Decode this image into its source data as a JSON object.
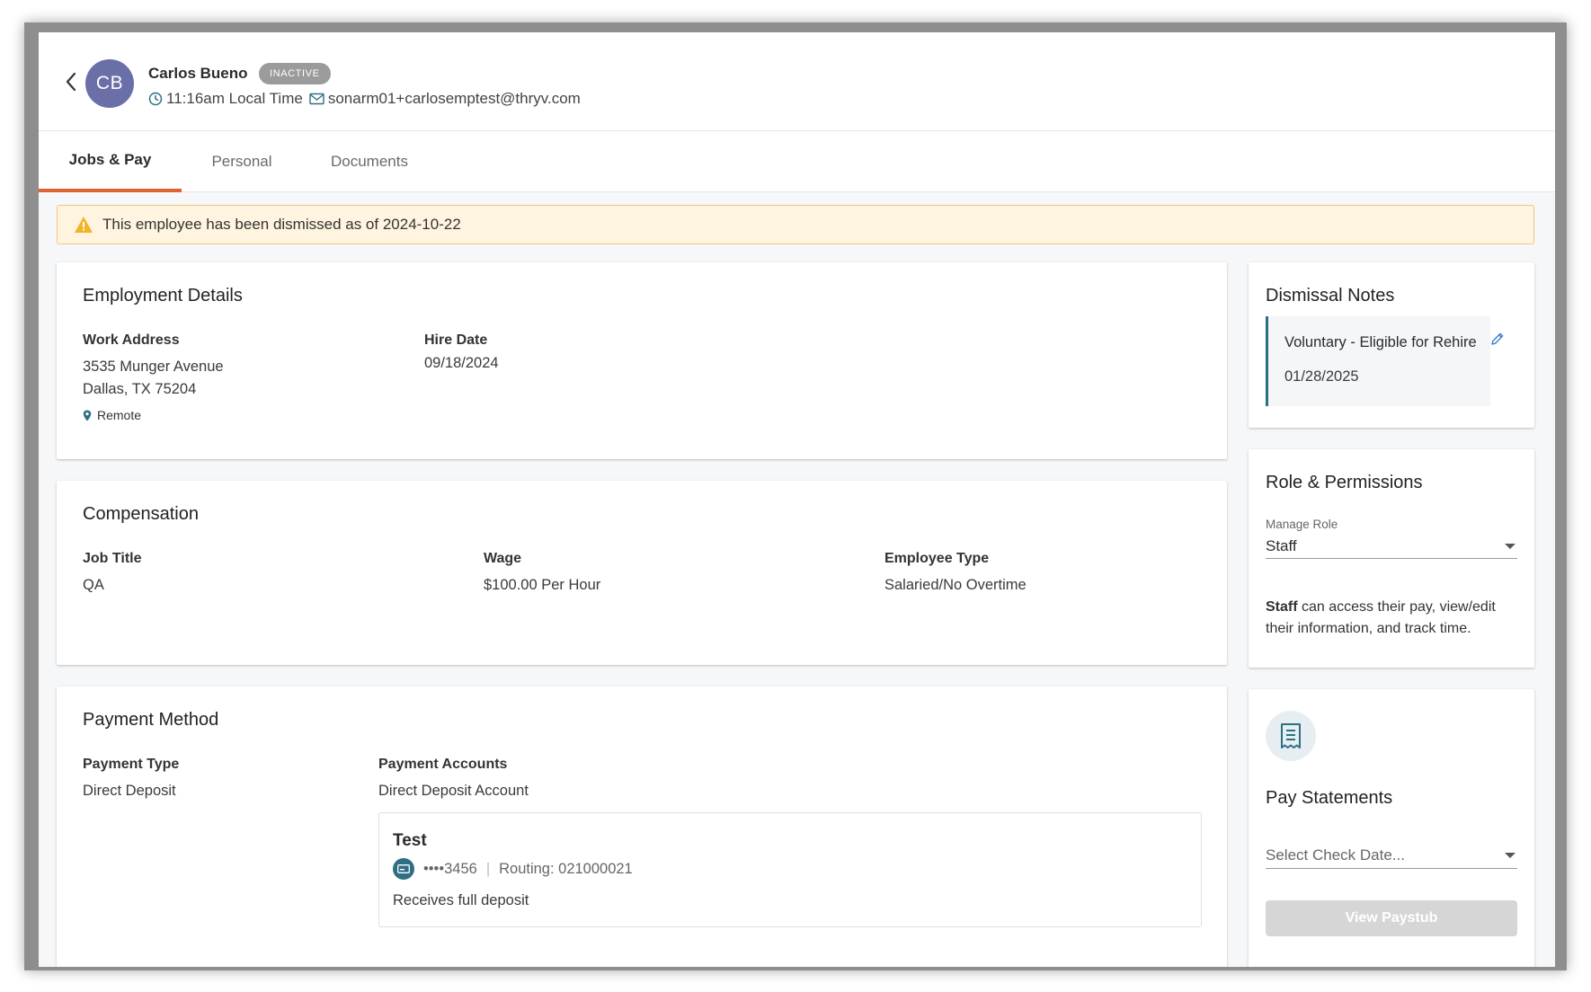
{
  "header": {
    "initials": "CB",
    "name": "Carlos Bueno",
    "status": "INACTIVE",
    "local_time": "11:16am Local Time",
    "email": "sonarm01+carlosemptest@thryv.com"
  },
  "tabs": [
    {
      "label": "Jobs & Pay",
      "active": true
    },
    {
      "label": "Personal",
      "active": false
    },
    {
      "label": "Documents",
      "active": false
    }
  ],
  "alert": {
    "text": "This employee has been dismissed as of 2024-10-22"
  },
  "employment": {
    "title": "Employment Details",
    "work_address_label": "Work Address",
    "address_line1": "3535 Munger Avenue",
    "address_line2": "Dallas, TX 75204",
    "remote": "Remote",
    "hire_date_label": "Hire Date",
    "hire_date": "09/18/2024"
  },
  "compensation": {
    "title": "Compensation",
    "job_title_label": "Job Title",
    "job_title": "QA",
    "wage_label": "Wage",
    "wage": "$100.00 Per Hour",
    "employee_type_label": "Employee Type",
    "employee_type": "Salaried/No Overtime"
  },
  "payment": {
    "title": "Payment Method",
    "payment_type_label": "Payment Type",
    "payment_type": "Direct Deposit",
    "accounts_label": "Payment Accounts",
    "accounts_sub": "Direct Deposit Account",
    "account_name": "Test",
    "account_number": "••••3456",
    "routing": "Routing: 021000021",
    "deposit_note": "Receives full deposit"
  },
  "dismissal": {
    "title": "Dismissal Notes",
    "reason": "Voluntary - Eligible for Rehire",
    "date": "01/28/2025"
  },
  "role": {
    "title": "Role & Permissions",
    "manage_label": "Manage Role",
    "selected": "Staff",
    "desc_bold": "Staff",
    "desc_rest": " can access their pay, view/edit their information, and track time."
  },
  "pay_statements": {
    "title": "Pay Statements",
    "select_placeholder": "Select Check Date...",
    "button": "View Paystub"
  },
  "colors": {
    "accent_tab": "#e0622e",
    "avatar": "#6b6fa8",
    "teal": "#2f6f83",
    "alert_bg": "#fff4e0",
    "alert_border": "#f3c67a",
    "warning_icon": "#f0b429"
  }
}
